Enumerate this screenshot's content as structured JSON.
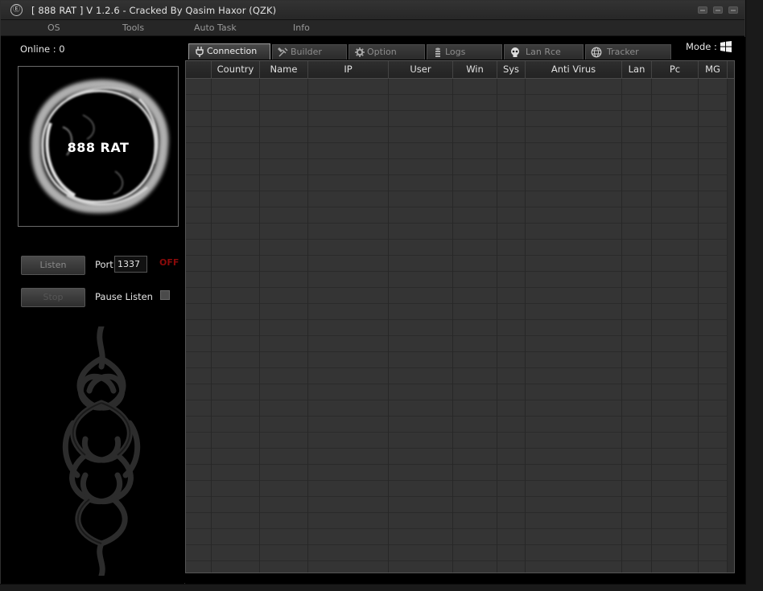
{
  "window": {
    "title": "[  888 RAT  ] V 1.2.6 - Cracked By Qasim Haxor (QZK)",
    "icon": "app-logo-icon"
  },
  "menu": [
    {
      "label": "OS"
    },
    {
      "label": "Tools"
    },
    {
      "label": "Auto Task"
    },
    {
      "label": "Info"
    }
  ],
  "left": {
    "online_label": "Online : 0",
    "logo_text": "888 RAT",
    "listen_label": "Listen",
    "stop_label": "Stop",
    "port_label": "Port",
    "port_value": "1337",
    "status_text": "OFF",
    "pause_label": "Pause Listen",
    "pause_checked": false
  },
  "tabs": [
    {
      "label": "Connection",
      "icon": "plug-icon",
      "active": true
    },
    {
      "label": "Builder",
      "icon": "tools-icon",
      "active": false
    },
    {
      "label": "Option",
      "icon": "gear-icon",
      "active": false
    },
    {
      "label": "Logs",
      "icon": "database-icon",
      "active": false
    },
    {
      "label": "Lan Rce",
      "icon": "skull-icon",
      "active": false
    },
    {
      "label": "Tracker",
      "icon": "globe-icon",
      "active": false
    }
  ],
  "mode": {
    "label": "Mode :",
    "icon": "windows-icon"
  },
  "table": {
    "columns": [
      "",
      "Country",
      "Name",
      "IP",
      "User",
      "Win",
      "Sys",
      "Anti Virus",
      "Lan",
      "Pc",
      "MG"
    ],
    "rows": []
  },
  "colors": {
    "status_off": "#8b0a0a",
    "grid_bg": "#343434",
    "window_bg": "#000000"
  }
}
